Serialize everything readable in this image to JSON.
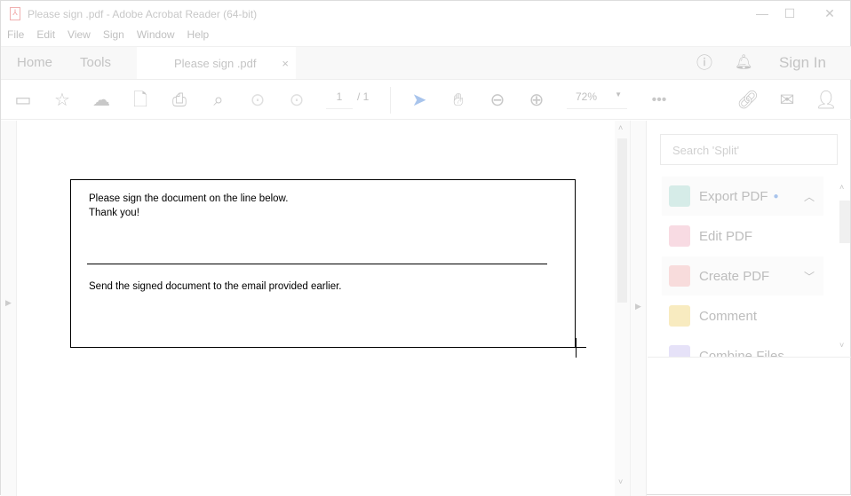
{
  "window": {
    "title": "Please sign .pdf - Adobe Acrobat Reader (64-bit)",
    "minimize": "—",
    "maximize": "☐",
    "close": "✕"
  },
  "menu": [
    "File",
    "Edit",
    "View",
    "Sign",
    "Window",
    "Help"
  ],
  "tabs": {
    "home": "Home",
    "tools": "Tools",
    "document": "Please sign .pdf",
    "close": "×",
    "sign_in": "Sign In"
  },
  "toolbar": {
    "page_current": "1",
    "page_total": "/ 1",
    "zoom": "72%"
  },
  "document": {
    "line1": "Please sign the document on the line below.",
    "line2": "Thank you!",
    "line3": "Send the signed document to the email provided earlier."
  },
  "right_panel": {
    "search_placeholder": "Search 'Split'",
    "tools": [
      {
        "label": "Export PDF",
        "color": "#9fd0c6"
      },
      {
        "label": "Edit PDF",
        "color": "#f2b4c4"
      },
      {
        "label": "Create PDF",
        "color": "#f2b0b0"
      },
      {
        "label": "Comment",
        "color": "#f5dc8a"
      },
      {
        "label": "Combine Files",
        "color": "#c8c0f0"
      }
    ]
  }
}
